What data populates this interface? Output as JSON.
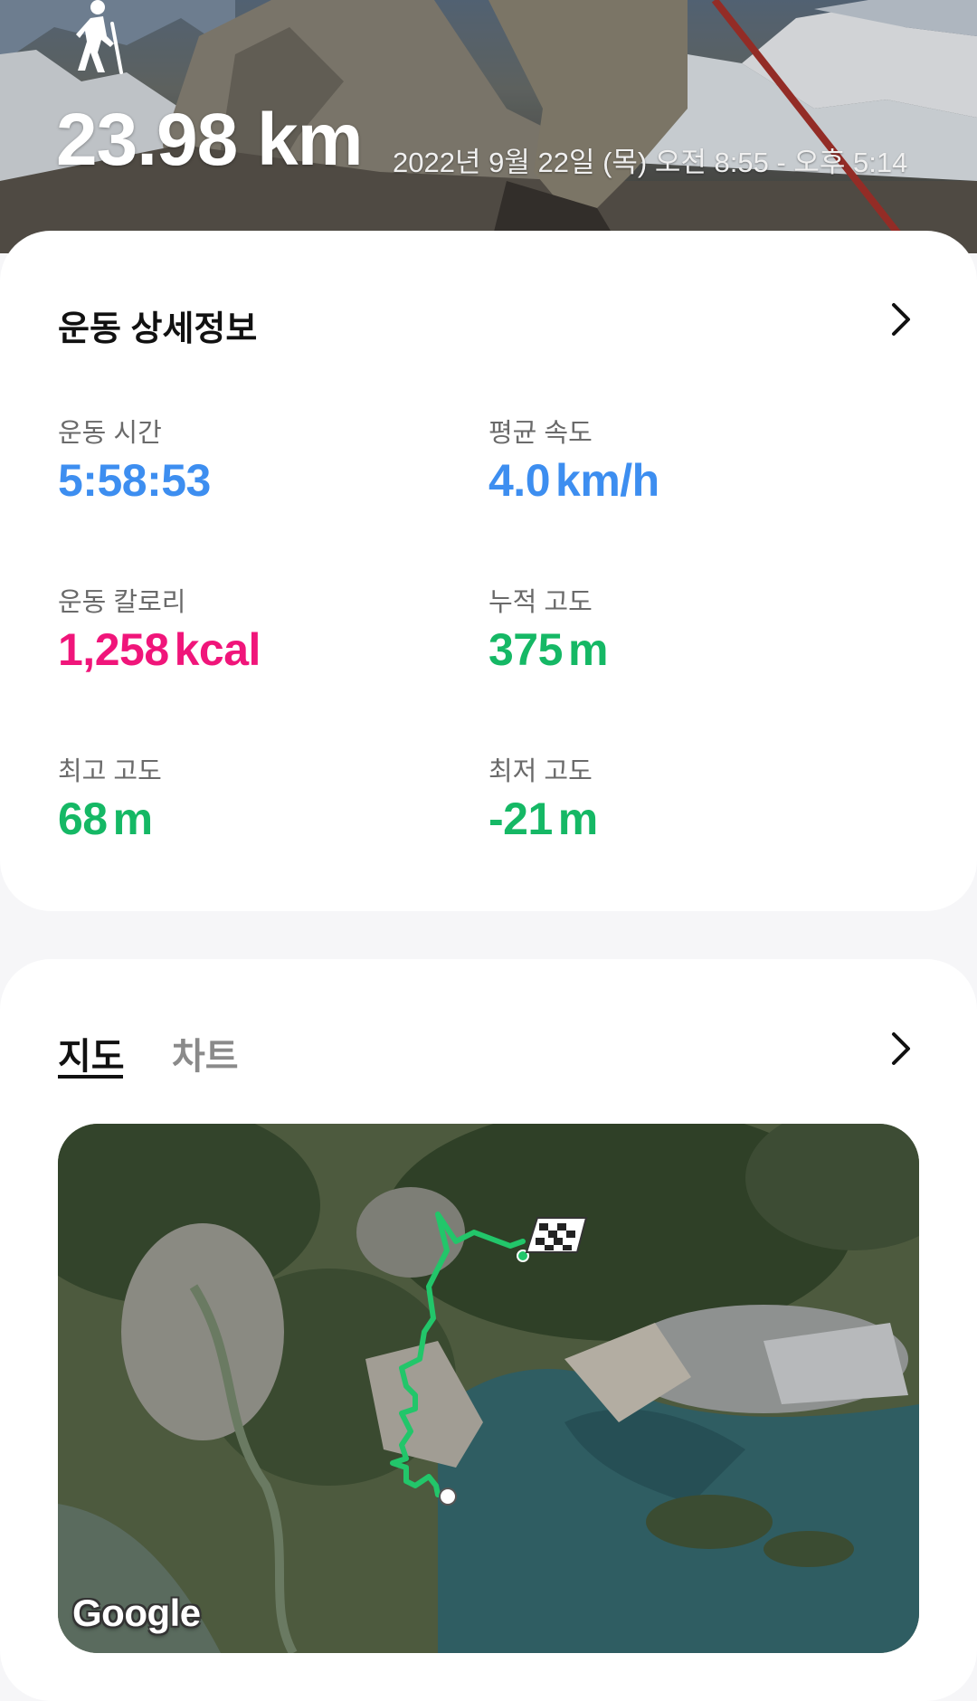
{
  "hero": {
    "distance": "23.98 km",
    "datetime": "2022년 9월 22일 (목) 오전 8:55 - 오후 5:14",
    "activity_icon": "hiking-icon"
  },
  "details": {
    "title": "운동 상세정보",
    "stats": [
      {
        "label": "운동 시간",
        "value": "5:58:53",
        "unit": "",
        "color": "#3d8ef0"
      },
      {
        "label": "평균 속도",
        "value": "4.0",
        "unit": "km/h",
        "color": "#3d8ef0"
      },
      {
        "label": "운동 칼로리",
        "value": "1,258",
        "unit": "kcal",
        "color": "#f0157a"
      },
      {
        "label": "누적 고도",
        "value": "375",
        "unit": "m",
        "color": "#15b865"
      },
      {
        "label": "최고 고도",
        "value": "68",
        "unit": "m",
        "color": "#15b865"
      },
      {
        "label": "최저 고도",
        "value": "-21",
        "unit": "m",
        "color": "#15b865"
      }
    ]
  },
  "tabs": [
    {
      "label": "지도",
      "active": true
    },
    {
      "label": "차트",
      "active": false
    }
  ],
  "map": {
    "brand": "Google",
    "route_color": "#22c66a",
    "start_marker": "finish-flag-icon",
    "end_marker": "start-dot-icon"
  }
}
